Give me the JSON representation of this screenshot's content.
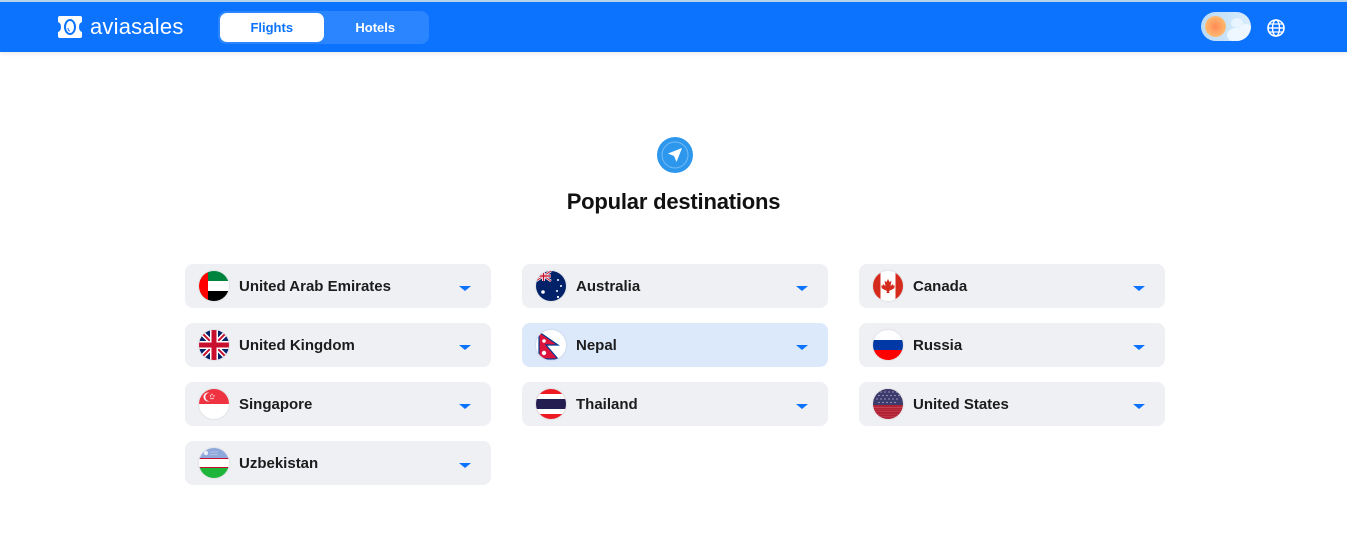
{
  "header": {
    "brand": "aviasales",
    "tabs": [
      {
        "label": "Flights",
        "active": true
      },
      {
        "label": "Hotels",
        "active": false
      }
    ],
    "theme_toggle": "day-mode",
    "language_icon": "globe-icon"
  },
  "main": {
    "icon": "navigation-arrow-icon",
    "title": "Popular destinations",
    "destinations": [
      {
        "label": "United Arab Emirates",
        "flag": "uae"
      },
      {
        "label": "Australia",
        "flag": "australia"
      },
      {
        "label": "Canada",
        "flag": "canada"
      },
      {
        "label": "United Kingdom",
        "flag": "uk"
      },
      {
        "label": "Nepal",
        "flag": "nepal",
        "highlighted": true
      },
      {
        "label": "Russia",
        "flag": "russia"
      },
      {
        "label": "Singapore",
        "flag": "singapore"
      },
      {
        "label": "Thailand",
        "flag": "thailand"
      },
      {
        "label": "United States",
        "flag": "usa"
      },
      {
        "label": "Uzbekistan",
        "flag": "uzbekistan"
      }
    ]
  },
  "colors": {
    "brand_blue": "#0c73fe",
    "card_bg": "#eff0f4",
    "card_highlight_bg": "#dbe9fb",
    "hero_icon_bg": "#2d97ee"
  }
}
